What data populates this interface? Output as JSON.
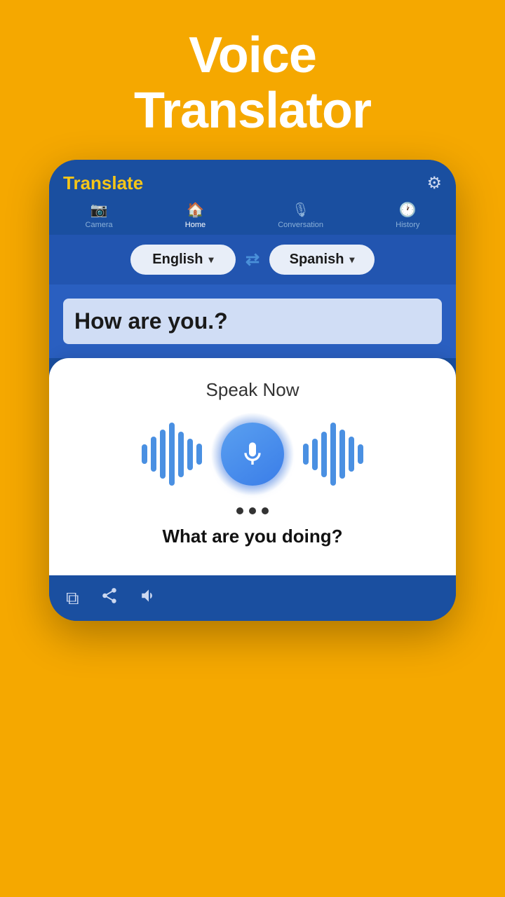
{
  "app": {
    "background_color": "#F5A800",
    "title_line1": "Voice",
    "title_line2": "Translator"
  },
  "phone": {
    "header": {
      "title": "Translate",
      "settings_icon": "⚙"
    },
    "nav": {
      "items": [
        {
          "id": "camera",
          "label": "Camera",
          "icon": "📷",
          "active": false
        },
        {
          "id": "home",
          "label": "Home",
          "icon": "🏠",
          "active": true
        },
        {
          "id": "conversation",
          "label": "Conversation",
          "icon": "🎙",
          "active": false
        },
        {
          "id": "history",
          "label": "History",
          "icon": "🕐",
          "active": false
        }
      ]
    },
    "language_selector": {
      "source_language": "English",
      "target_language": "Spanish",
      "swap_icon": "⇄"
    },
    "source_text": "How are you.?",
    "speak_modal": {
      "label": "Speak Now",
      "dots_count": 3,
      "translated_text": "What are you doing?"
    },
    "action_bar": {
      "copy_icon": "⧉",
      "share_icon": "⎋",
      "sound_icon": "🔊"
    }
  }
}
